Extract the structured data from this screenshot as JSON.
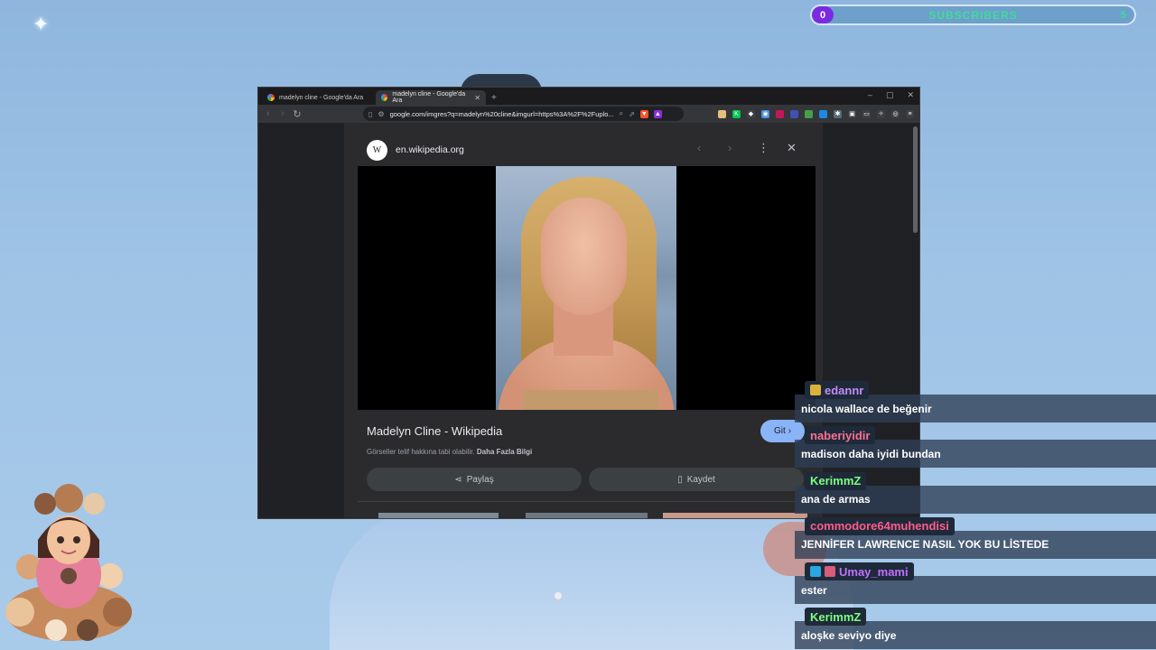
{
  "subscribers": {
    "current": "0",
    "label": "SUBSCRIBERS",
    "goal": "5"
  },
  "browser": {
    "tabs": [
      {
        "title": "madelyn cline - Google'da Ara",
        "active": false
      },
      {
        "title": "madelyn cline - Google'da Ara",
        "active": true
      }
    ],
    "new_tab": "+",
    "url": "google.com/imgres?q=madelyn%20cline&imgurl=https%3A%2F%2Fuplo...",
    "controls": {
      "minimize": "–",
      "maximize": "▢",
      "close": "✕"
    }
  },
  "image_panel": {
    "source_badge": "W",
    "source_domain": "en.wikipedia.org",
    "title": "Madelyn Cline - Wikipedia",
    "go_label": "Git",
    "copyright_text": "Görseller telif hakkına tabi olabilir.",
    "more_info": "Daha Fazla Bilgi",
    "share_label": "Paylaş",
    "save_label": "Kaydet"
  },
  "chat": [
    {
      "user": "edannr",
      "user_color": "#c58af9",
      "badge": "trophy",
      "message": "nicola wallace de beğenir"
    },
    {
      "user": "naberiyidir",
      "user_color": "#ff6f91",
      "badge": "",
      "message": "madison daha iyidi bundan"
    },
    {
      "user": "KerimmZ",
      "user_color": "#7dff7d",
      "badge": "",
      "message": "ana de armas"
    },
    {
      "user": "commodore64muhendisi",
      "user_color": "#ff5c8a",
      "badge": "",
      "message": "JENNİFER LAWRENCE NASIL YOK BU LİSTEDE"
    },
    {
      "user": "Umay_mami",
      "user_color": "#c070ff",
      "badge": "cube",
      "message": "ester"
    },
    {
      "user": "KerimmZ",
      "user_color": "#7dff7d",
      "badge": "",
      "message": "aloşke seviyo diye"
    }
  ],
  "colors": {
    "accent_blue": "#8ab4f8",
    "subscriber_green": "#3fdc9a",
    "subscriber_purple": "#7a2be2"
  }
}
